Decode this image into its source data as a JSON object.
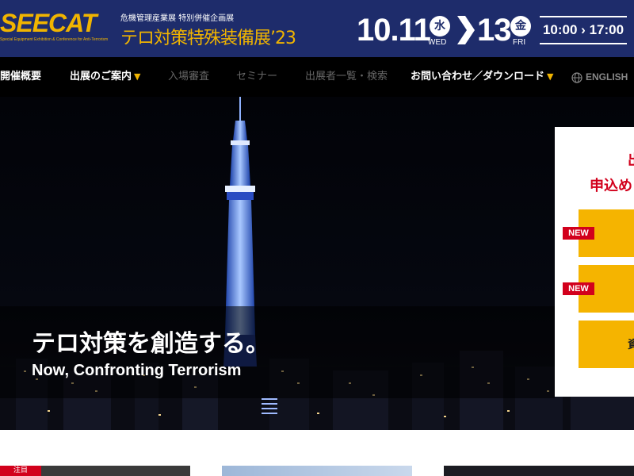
{
  "header": {
    "logo_text": "SEECAT",
    "logo_subtitle": "Special Equipment Exhibition & Conference for Anti-Terrorism",
    "expo_subtitle": "危機管理産業展 特別併催企画展",
    "expo_title": "テロ対策特殊装備展’23",
    "date_start": "10.11",
    "day_start": "水",
    "day_start_en": "WED",
    "date_end": "13",
    "day_end": "金",
    "day_end_en": "FRI",
    "time_start": "10:00",
    "time_end": "17:00"
  },
  "nav": {
    "items": [
      {
        "label": "開催概要"
      },
      {
        "label": "出展のご案内",
        "caret": "▼"
      },
      {
        "label": "入場審査"
      },
      {
        "label": "セミナー"
      },
      {
        "label": "出展者一覧・検索"
      },
      {
        "label": "お問い合わせ／ダウンロード",
        "caret": "▼"
      },
      {
        "label": "ENGLISH"
      }
    ]
  },
  "hero": {
    "title_jp": "テロ対策を創造する。",
    "title_en": "Now, Confronting Terrorism"
  },
  "panel": {
    "line1": "出",
    "line2": "申込め",
    "buttons": [
      {
        "tag": "NEW",
        "label": ""
      },
      {
        "tag": "NEW",
        "label": ""
      },
      {
        "tag": "",
        "label": "資"
      }
    ]
  },
  "cards": [
    {
      "tag": "注目"
    }
  ],
  "colors": {
    "header_bg": "#1e2c6b",
    "accent": "#f0b400",
    "nav_bg": "#000000",
    "red": "#d2001c",
    "button_yellow": "#f5b400"
  }
}
